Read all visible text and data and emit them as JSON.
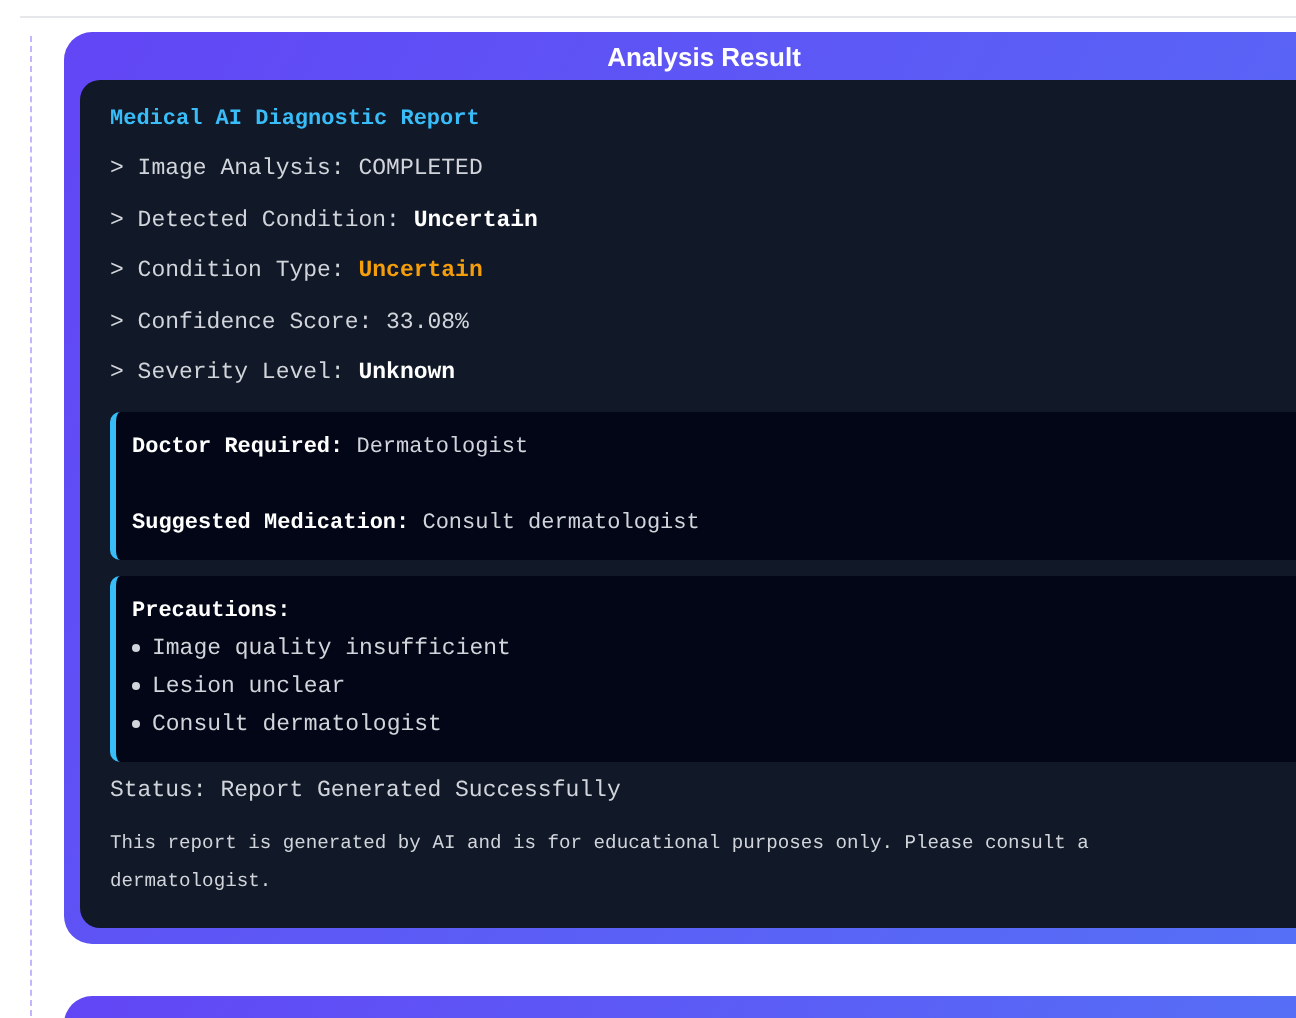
{
  "card": {
    "title": "Analysis Result"
  },
  "report": {
    "heading": "Medical AI Diagnostic Report",
    "rows": [
      {
        "label": "> Image Analysis:",
        "value": "COMPLETED",
        "kind": "plain"
      },
      {
        "label": "> Detected Condition:",
        "value": "Uncertain",
        "kind": "bold"
      },
      {
        "label": "> Condition Type:",
        "value": "Uncertain",
        "kind": "warning"
      },
      {
        "label": "> Confidence Score:",
        "value": "33.08%",
        "kind": "plain"
      },
      {
        "label": "> Severity Level:",
        "value": "Unknown",
        "kind": "bold"
      }
    ],
    "doctor": {
      "label": "Doctor Required:",
      "value": "Dermatologist"
    },
    "medication": {
      "label": "Suggested Medication:",
      "value": "Consult dermatologist"
    },
    "precautions": {
      "heading": "Precautions:",
      "items": [
        "Image quality insufficient",
        "Lesion unclear",
        "Consult dermatologist"
      ]
    },
    "status": "Status: Report Generated Successfully",
    "disclaimer": "This report is generated by AI and is for educational purposes only. Please consult a dermatologist."
  }
}
